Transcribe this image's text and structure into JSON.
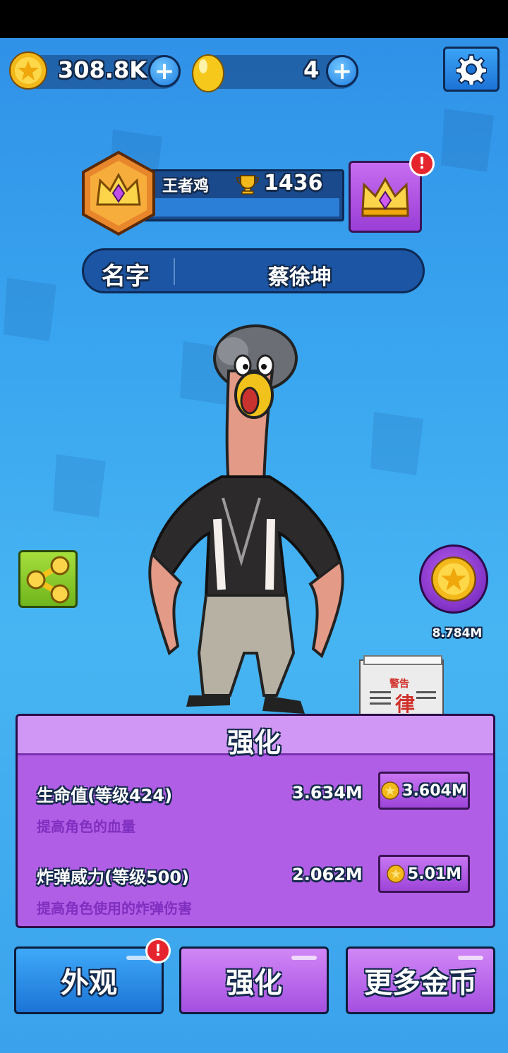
{
  "currency": {
    "coins": "308.8K",
    "eggs": "4"
  },
  "rank": {
    "title": "王者鸡",
    "score": "1436"
  },
  "profile": {
    "name_label": "名字",
    "name_value": "蔡徐坤"
  },
  "side": {
    "coin_bonus": "8.784M"
  },
  "upgrade_panel": {
    "title": "强化",
    "rows": [
      {
        "label": "生命值(等级424)",
        "description": "提高角色的血量",
        "current": "3.634M",
        "cost": "3.604M"
      },
      {
        "label": "炸弹威力(等级500)",
        "description": "提高角色使用的炸弹伤害",
        "current": "2.062M",
        "cost": "5.01M"
      }
    ]
  },
  "tabs": [
    {
      "label": "外观"
    },
    {
      "label": "强化"
    },
    {
      "label": "更多金币"
    }
  ],
  "alerts": {
    "icon": "!"
  },
  "newspaper": {
    "headline": "警告",
    "glyph": "律"
  },
  "colors": {
    "background": "#3aa6f0",
    "panel": "#b15ee6",
    "panel_header": "#d197f4",
    "blue_button": "#1c74d6",
    "purple_button": "#a44fe0",
    "alert": "#e6242e"
  },
  "icons": [
    "coin-icon",
    "egg-icon",
    "plus-icon",
    "gear-icon",
    "trophy-icon",
    "crown-icon",
    "share-icon",
    "alert-icon"
  ]
}
